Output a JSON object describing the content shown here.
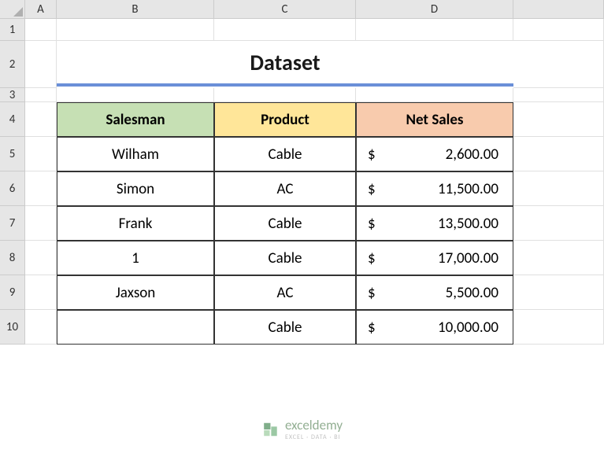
{
  "columns": [
    "A",
    "B",
    "C",
    "D"
  ],
  "rows": [
    "1",
    "2",
    "3",
    "4",
    "5",
    "6",
    "7",
    "8",
    "9",
    "10"
  ],
  "title": "Dataset",
  "headers": {
    "salesman": "Salesman",
    "product": "Product",
    "netsales": "Net Sales"
  },
  "data": [
    {
      "salesman": "Wilham",
      "product": "Cable",
      "currency": "$",
      "amount": "2,600.00"
    },
    {
      "salesman": "Simon",
      "product": "AC",
      "currency": "$",
      "amount": "11,500.00"
    },
    {
      "salesman": "Frank",
      "product": "Cable",
      "currency": "$",
      "amount": "13,500.00"
    },
    {
      "salesman": "1",
      "product": "Cable",
      "currency": "$",
      "amount": "17,000.00"
    },
    {
      "salesman": "Jaxson",
      "product": "AC",
      "currency": "$",
      "amount": "5,500.00"
    },
    {
      "salesman": "",
      "product": "Cable",
      "currency": "$",
      "amount": "10,000.00"
    }
  ],
  "watermark": {
    "name": "exceldemy",
    "tagline": "EXCEL · DATA · BI"
  }
}
